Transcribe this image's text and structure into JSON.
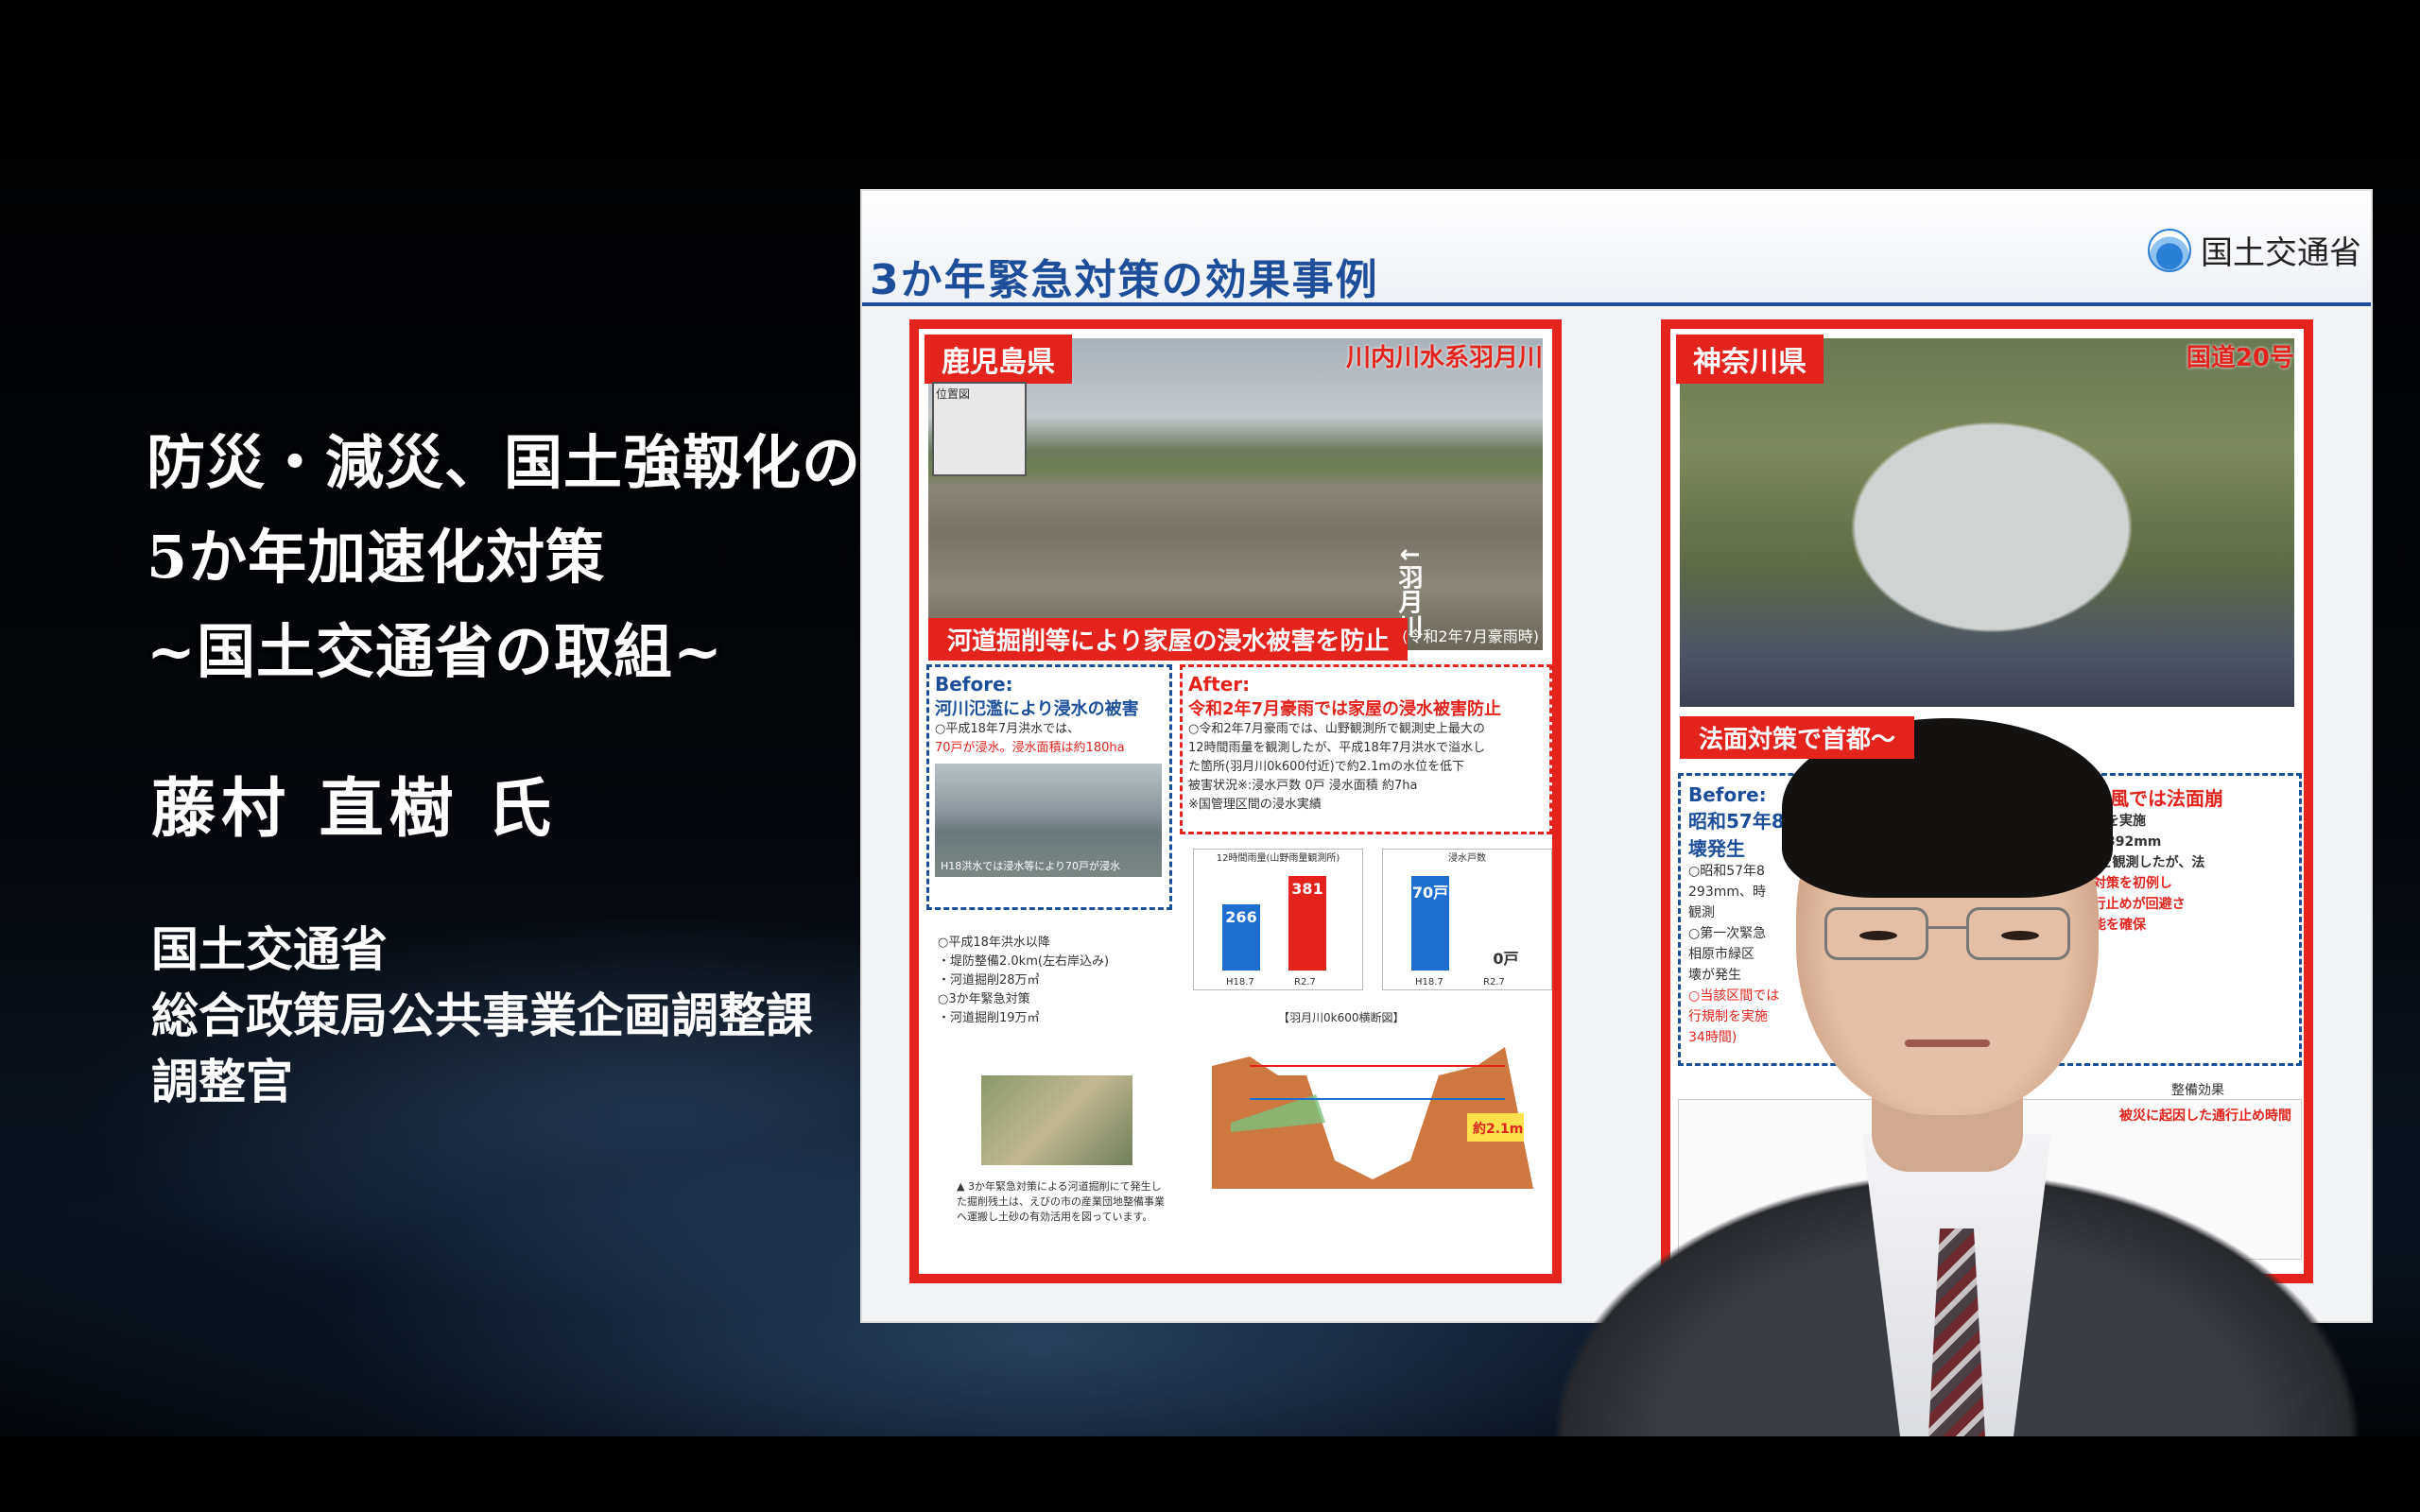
{
  "title_lines": [
    "防災・減災、国土強靱化のための",
    "5か年加速化対策",
    "~国土交通省の取組~"
  ],
  "speaker": "藤村 直樹 氏",
  "affiliation_lines": [
    "国土交通省",
    "総合政策局公共事業企画調整課",
    "調整官"
  ],
  "slide": {
    "title": "3か年緊急対策の効果事例",
    "ministry": "国土交通省",
    "left": {
      "prefecture": "鹿児島県",
      "river": "川内川水系羽月川",
      "map_label": "位置図",
      "river_vertical": "羽月川",
      "photo_caption": "河道掘削等により家屋の浸水被害を防止",
      "photo_date": "(令和2年7月豪雨時)",
      "before_title": "Before:",
      "before_head": "河川氾濫により浸水の被害",
      "before_line1": "○平成18年7月洪水では、",
      "before_line2": "70戸が浸水。浸水面積は約180ha",
      "before_photo_cap": "H18洪水では浸水等により70戸が浸水",
      "after_title": "After:",
      "after_head": "令和2年7月豪雨では家屋の浸水被害防止",
      "after_line1": "○令和2年7月豪雨では、山野観測所で観測史上最大の",
      "after_line2": "12時間雨量を観測したが、平成18年7月洪水で溢水し",
      "after_line3": "た箇所(羽月川0k600付近)で約2.1mの水位を低下",
      "after_line4": "被害状況※:浸水戸数 0戸 浸水面積 約7ha",
      "after_line5": "※国管理区間の浸水実績",
      "chart1_title": "12時間雨量(山野雨量観測所)",
      "chart1_v1": "266",
      "chart1_v2": "381",
      "chart1_x1": "H18.7",
      "chart1_x2": "R2.7",
      "chart2_title": "浸水戸数",
      "chart2_v1": "70戸",
      "chart2_v2": "0戸",
      "chart2_x1": "H18.7",
      "chart2_x2": "R2.7",
      "measure1": "○平成18年洪水以降",
      "measure2": "・堤防整備2.0km(左右岸込み)",
      "measure3": "・河道掘削28万㎥",
      "measure4": "○3か年緊急対策",
      "measure5": "・河道掘削19万㎥",
      "site_caption": "▲ 3か年緊急対策による河道掘削にて発生した掘削残土は、えびの市の産業団地整備事業へ運搬し土砂の有効活用を図っています。",
      "cs_title": "【羽月川0k600横断図】",
      "cs_drop": "約2.1m"
    },
    "right": {
      "prefecture": "神奈川県",
      "route": "国道20号",
      "photo_caption": "法面対策で首都～",
      "before_title": "Before:",
      "before_head": "昭和57年8",
      "before_head2": "壊発生",
      "before_line1": "○昭和57年8",
      "before_line2": "293mm、時",
      "before_line3": "観測",
      "before_line4": "○第一次緊急",
      "before_line5": "相原市緑区",
      "before_line6": "壊が発生",
      "before_line7": "○当該区間では",
      "before_line8": "行規制を実施",
      "before_line9": "34時間)",
      "right_head": "日本台風では法面崩",
      "right_line1": "法面対策を実施",
      "right_line2": "連続雨量392mm",
      "right_line3": "43mmを観測したが、法",
      "right_line4": "、法面対策を初例し",
      "right_line5": "よる通行止めが回避さ",
      "right_line6": "通行機能を確保",
      "effect_label": "整備効果",
      "effect_sub": "被災に起因した通行止め時間"
    }
  }
}
